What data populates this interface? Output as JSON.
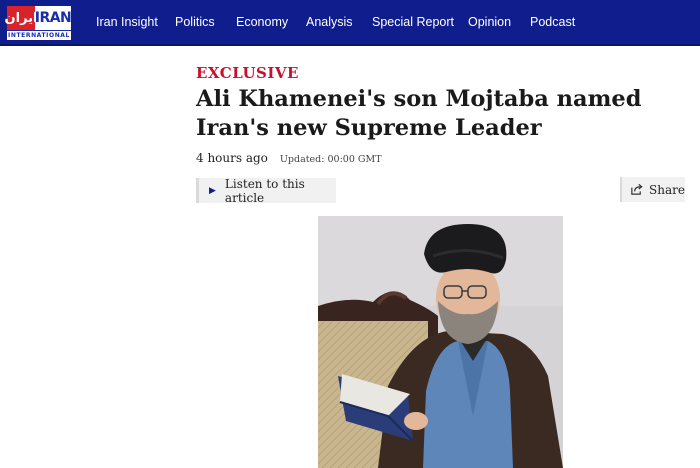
{
  "logo": {
    "fa_text": "ایران",
    "en_text": "IRAN",
    "sub_text": "INTERNATIONAL"
  },
  "nav": {
    "items": [
      {
        "label": "Iran Insight"
      },
      {
        "label": "Politics"
      },
      {
        "label": "Economy"
      },
      {
        "label": "Analysis"
      },
      {
        "label": "Special Report"
      },
      {
        "label": "Opinion"
      },
      {
        "label": "Podcast"
      }
    ]
  },
  "article": {
    "kicker": "EXCLUSIVE",
    "headline": "Ali Khamenei's son Mojtaba named Iran's new Supreme Leader",
    "time_ago": "4 hours ago",
    "updated": "Updated: 00:00 GMT",
    "listen_label": "Listen to this article",
    "share_label": "Share"
  },
  "colors": {
    "nav_bg": "#101d8c",
    "kicker": "#c8102e",
    "logo_red": "#d8232a"
  },
  "icons": {
    "play": "play-icon",
    "share": "share-icon"
  }
}
